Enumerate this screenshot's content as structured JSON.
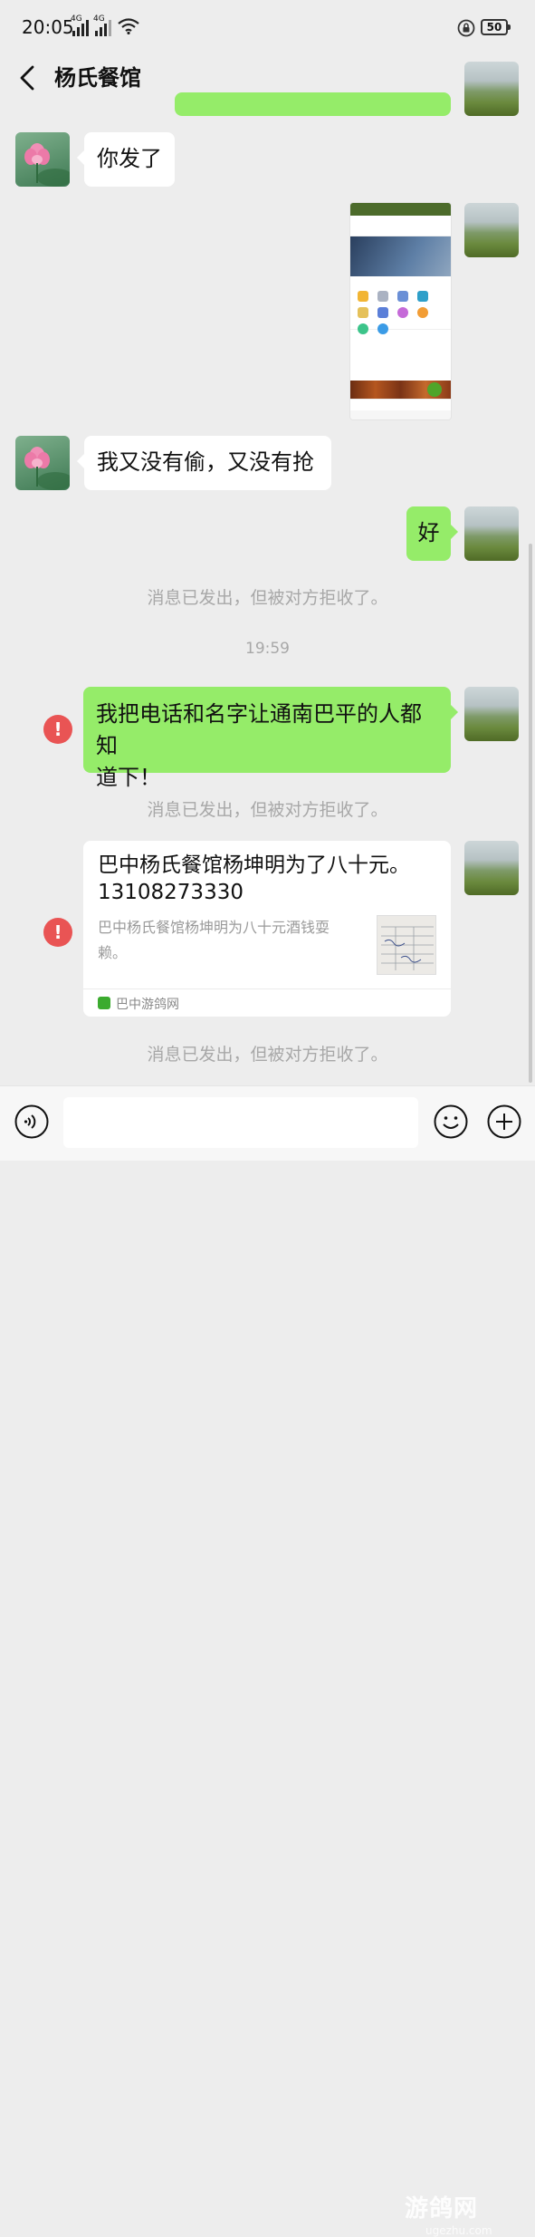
{
  "status_bar": {
    "time": "20:05",
    "network_1": "4G",
    "network_2": "4G",
    "battery": "50"
  },
  "nav": {
    "title": "杨氏餐馆"
  },
  "messages": {
    "m1": "你发了",
    "m2": "我又没有偷，又没有抢",
    "m3": "好",
    "m4_line1": "我把电话和名字让通南巴平的人都知",
    "m4_line2": "道下！"
  },
  "system": {
    "rejected_1": "消息已发出，但被对方拒收了。",
    "time": "19:59",
    "rejected_2": "消息已发出，但被对方拒收了。",
    "rejected_3": "消息已发出，但被对方拒收了。"
  },
  "error_icon_glyph": "!",
  "card": {
    "title_line1": "巴中杨氏餐馆杨坤明为了八十元。",
    "title_line2": "13108273330",
    "desc_line1": "巴中杨氏餐馆杨坤明为八十元酒钱耍",
    "desc_line2": "赖。",
    "source": "巴中游鸽网"
  },
  "input": {
    "placeholder": ""
  },
  "watermark": {
    "text": "游鸽网",
    "sub": "ugezhu.com"
  },
  "colors": {
    "self_bubble": "#95ec69",
    "other_bubble": "#ffffff",
    "background": "#ededed",
    "error": "#e95454"
  }
}
